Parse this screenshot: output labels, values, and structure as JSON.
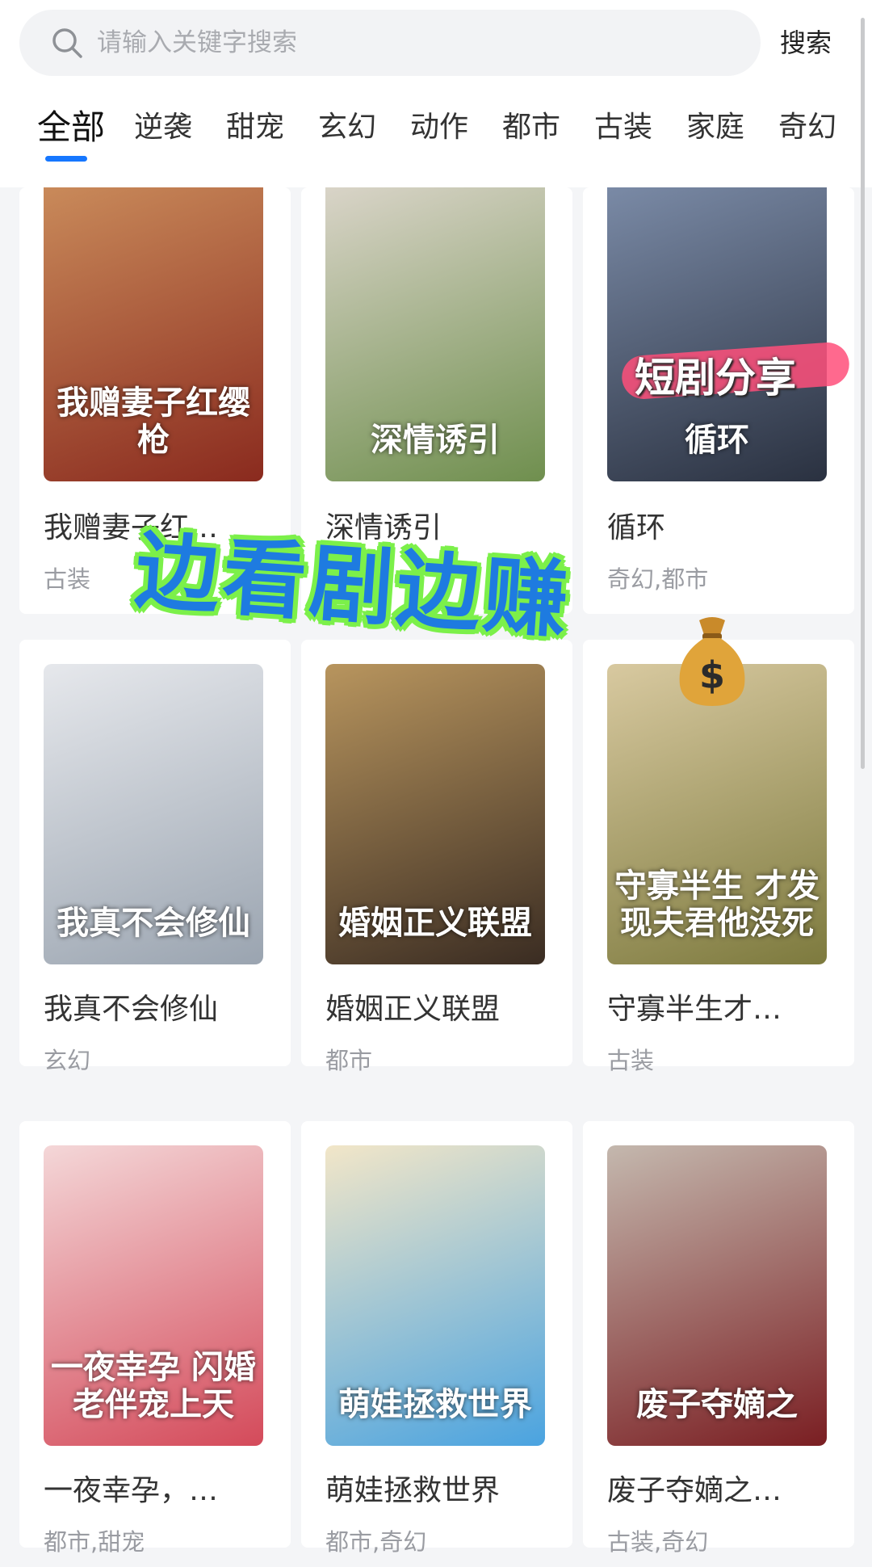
{
  "search": {
    "placeholder": "请输入关键字搜索",
    "button_label": "搜索"
  },
  "tabs": [
    {
      "label": "全部",
      "active": true
    },
    {
      "label": "逆袭",
      "active": false
    },
    {
      "label": "甜宠",
      "active": false
    },
    {
      "label": "玄幻",
      "active": false
    },
    {
      "label": "动作",
      "active": false
    },
    {
      "label": "都市",
      "active": false
    },
    {
      "label": "古装",
      "active": false
    },
    {
      "label": "家庭",
      "active": false
    },
    {
      "label": "奇幻",
      "active": false
    }
  ],
  "cards": [
    {
      "title": "我赠妻子红…",
      "tags": "古装",
      "poster_text": "我赠妻子红缨枪",
      "colors": [
        "#8a2a1e",
        "#c98a5a"
      ]
    },
    {
      "title": "深情诱引",
      "tags": "都市",
      "poster_text": "深情诱引",
      "colors": [
        "#6f8f4e",
        "#d9d4c8"
      ]
    },
    {
      "title": "循环",
      "tags": "奇幻,都市",
      "poster_text": "循环",
      "colors": [
        "#2a3140",
        "#7a8aa6"
      ]
    },
    {
      "title": "我真不会修仙",
      "tags": "玄幻",
      "poster_text": "我真不会修仙",
      "colors": [
        "#9aa4b0",
        "#e6e8ec"
      ]
    },
    {
      "title": "婚姻正义联盟",
      "tags": "都市",
      "poster_text": "婚姻正义联盟",
      "colors": [
        "#3a2c22",
        "#b8955e"
      ]
    },
    {
      "title": "守寡半生才…",
      "tags": "古装",
      "poster_text": "守寡半生 才发现夫君他没死",
      "colors": [
        "#7d7a3e",
        "#d8c9a0"
      ]
    },
    {
      "title": "一夜幸孕，…",
      "tags": "都市,甜宠",
      "poster_text": "一夜幸孕 闪婚老伴宠上天",
      "colors": [
        "#d44a5a",
        "#f4d7d8"
      ]
    },
    {
      "title": "萌娃拯救世界",
      "tags": "都市,奇幻",
      "poster_text": "萌娃拯救世界",
      "colors": [
        "#4aa3e0",
        "#f2e6c8"
      ]
    },
    {
      "title": "废子夺嫡之…",
      "tags": "古装,奇幻",
      "poster_text": "废子夺嫡之",
      "colors": [
        "#7a1e22",
        "#c4b8ae"
      ]
    }
  ],
  "overlay": {
    "promo_text": "边看剧边赚",
    "watermark_text": "短剧分享"
  },
  "theme": {
    "accent": "#1677ff"
  }
}
